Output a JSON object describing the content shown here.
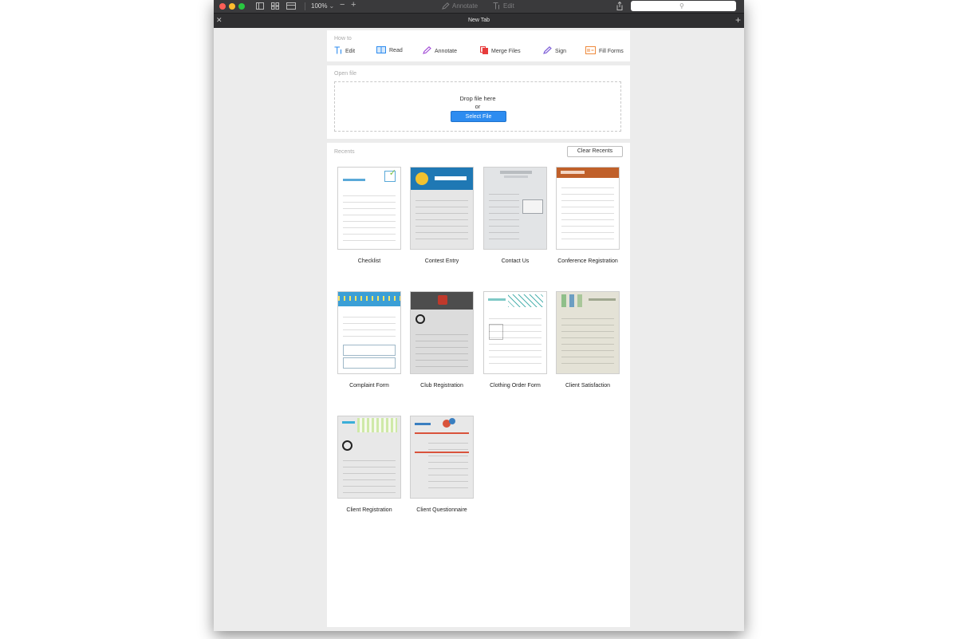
{
  "toolbar": {
    "zoom_label": "100%",
    "annotate_label": "Annotate",
    "edit_label": "Edit"
  },
  "tab": {
    "title": "New Tab"
  },
  "how_to": {
    "title": "How to",
    "items": [
      {
        "label": "Edit",
        "icon": "text-cursor-icon",
        "color": "#2d8cf0"
      },
      {
        "label": "Read",
        "icon": "book-icon",
        "color": "#2d8cf0"
      },
      {
        "label": "Annotate",
        "icon": "pen-icon",
        "color": "#a24bd6"
      },
      {
        "label": "Merge Files",
        "icon": "merge-icon",
        "color": "#e63c3c"
      },
      {
        "label": "Sign",
        "icon": "signature-pen-icon",
        "color": "#7b5cd6"
      },
      {
        "label": "Fill Forms",
        "icon": "form-fill-icon",
        "color": "#ef8a3c"
      }
    ]
  },
  "open_file": {
    "title": "Open file",
    "drop_text": "Drop file here",
    "or_text": "or",
    "select_button": "Select File"
  },
  "recents": {
    "title": "Recents",
    "clear_button": "Clear Recents",
    "items": [
      {
        "title": "Checklist",
        "accent": "#5aa9d8"
      },
      {
        "title": "Contest Entry",
        "accent": "#1f78b4"
      },
      {
        "title": "Contact Us",
        "accent": "#9ea3a8"
      },
      {
        "title": "Conference Registration",
        "accent": "#c0602a"
      },
      {
        "title": "Complaint Form",
        "accent": "#3b9fd6"
      },
      {
        "title": "Club Registration",
        "accent": "#4d4d4d"
      },
      {
        "title": "Clothing Order Form",
        "accent": "#4fb3b0"
      },
      {
        "title": "Client Satisfaction",
        "accent": "#7a9a6a"
      },
      {
        "title": "Client Registration",
        "accent": "#3aaed8"
      },
      {
        "title": "Client Questionnaire",
        "accent": "#d9533b"
      }
    ]
  }
}
